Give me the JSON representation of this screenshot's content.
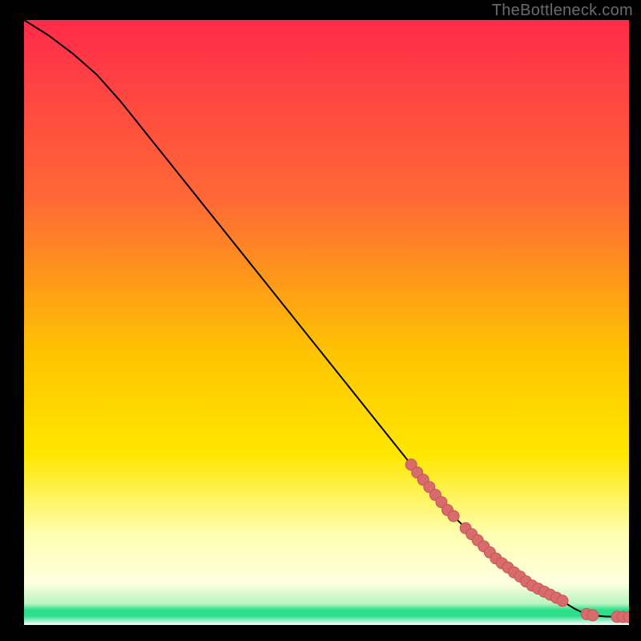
{
  "watermark": "TheBottleneck.com",
  "colors": {
    "frame_bg": "#000000",
    "line": "#000000",
    "marker_fill": "#d86b6b",
    "marker_stroke": "#c95555",
    "gradient_top": "#ff2b4a",
    "gradient_mid1": "#ff7a2e",
    "gradient_mid2": "#ffd400",
    "gradient_pale": "#ffffb0",
    "gradient_green": "#2cdf8a"
  },
  "chart_data": {
    "type": "line",
    "title": "",
    "xlabel": "",
    "ylabel": "",
    "xlim": [
      0,
      100
    ],
    "ylim": [
      0,
      100
    ],
    "legend": false,
    "grid": false,
    "series": [
      {
        "name": "curve",
        "x": [
          0,
          4,
          8,
          12,
          16,
          20,
          24,
          28,
          32,
          36,
          40,
          44,
          48,
          52,
          56,
          60,
          64,
          66,
          68,
          70,
          72,
          74,
          76,
          78,
          80,
          82,
          84,
          86,
          88,
          89,
          90,
          91,
          92,
          93,
          94,
          96,
          98,
          100
        ],
        "y": [
          100,
          97.5,
          94.5,
          91,
          86.5,
          81.5,
          76.5,
          71.5,
          66.5,
          61.5,
          56.5,
          51.5,
          46.5,
          41.5,
          36.5,
          31.5,
          26.5,
          24,
          21.5,
          19,
          17,
          15,
          13,
          11,
          9.5,
          8,
          6.5,
          5.5,
          4.5,
          4,
          3.3,
          2.7,
          2.2,
          1.8,
          1.6,
          1.4,
          1.35,
          1.3
        ]
      }
    ],
    "markers": {
      "name": "highlighted-points",
      "x": [
        64,
        65,
        66,
        67,
        68,
        69,
        70,
        71,
        73,
        74,
        75,
        76,
        77,
        78,
        79,
        80,
        81,
        82,
        83,
        84,
        85,
        86,
        87,
        88,
        89,
        93,
        94,
        98,
        99,
        100
      ],
      "y": [
        26.5,
        25.2,
        24,
        22.8,
        21.5,
        20.3,
        19,
        18,
        16,
        15,
        14,
        13,
        12,
        11,
        10.2,
        9.5,
        8.7,
        8,
        7.2,
        6.5,
        6,
        5.5,
        5,
        4.5,
        4,
        1.8,
        1.6,
        1.35,
        1.32,
        1.3
      ]
    },
    "background_gradient": {
      "stops": [
        {
          "offset": 0.0,
          "color": "#ff2b4a"
        },
        {
          "offset": 0.3,
          "color": "#ff6a35"
        },
        {
          "offset": 0.55,
          "color": "#ffc400"
        },
        {
          "offset": 0.72,
          "color": "#ffe700"
        },
        {
          "offset": 0.85,
          "color": "#ffffb0"
        },
        {
          "offset": 0.93,
          "color": "#ffffe0"
        },
        {
          "offset": 0.965,
          "color": "#b8f5c0"
        },
        {
          "offset": 0.975,
          "color": "#2cdf8a"
        },
        {
          "offset": 0.985,
          "color": "#2cdf8a"
        },
        {
          "offset": 1.0,
          "color": "#ffffff"
        }
      ]
    }
  }
}
